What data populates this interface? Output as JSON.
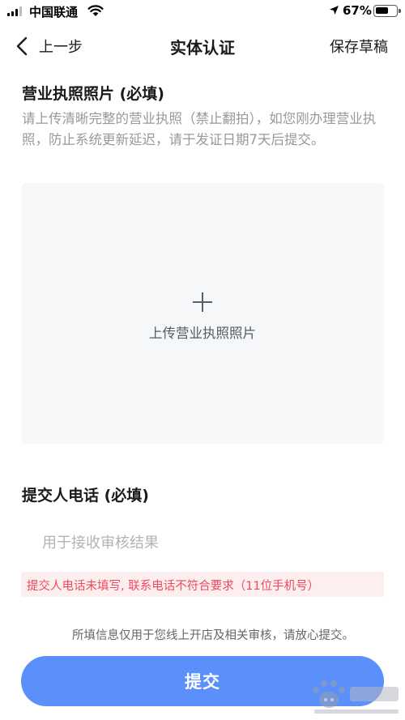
{
  "status_bar": {
    "carrier": "中国联通",
    "battery_percent": "67%",
    "battery_level": 0.67,
    "icons": [
      "signal-icon",
      "wifi-icon",
      "location-arrow-icon",
      "battery-icon"
    ]
  },
  "nav": {
    "back_label": "上一步",
    "title": "实体认证",
    "save_label": "保存草稿",
    "back_icon": "chevron-left-icon"
  },
  "license": {
    "title": "营业执照照片 (必填)",
    "description": "请上传清晰完整的营业执照（禁止翻拍），如您刚办理营业执照，防止系统更新延迟，请于发证日期7天后提交。",
    "upload_label": "上传营业执照照片",
    "upload_icon": "plus-icon"
  },
  "phone": {
    "title": "提交人电话 (必填)",
    "placeholder": "用于接收审核结果",
    "value": "",
    "error": "提交人电话未填写, 联系电话不符合要求（11位手机号）"
  },
  "notice": "所填信息仅用于您线上开店及相关审核，请放心提交。",
  "submit_label": "提交",
  "colors": {
    "accent": "#5b8ff9",
    "error_text": "#ef4a5a",
    "error_bg": "#fdeef0",
    "upload_bg": "#f6f7f9"
  }
}
